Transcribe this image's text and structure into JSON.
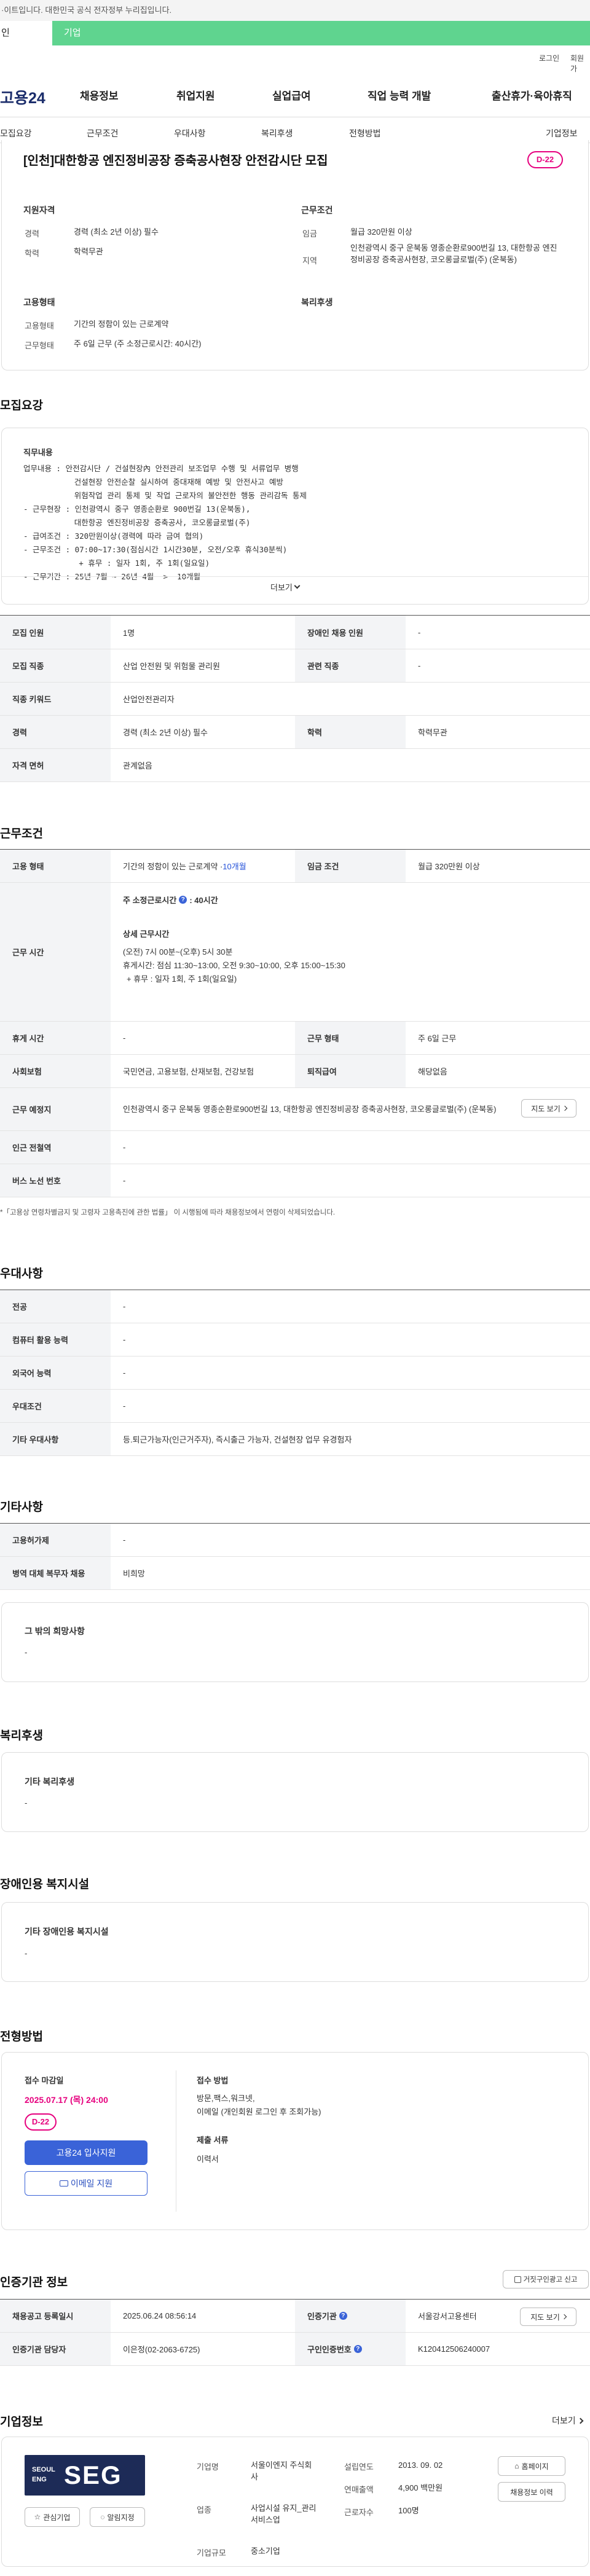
{
  "gov_banner": "·이트입니다. 대한민국 공식 전자정부 누리집입니다.",
  "user_tabs": [
    "인",
    "기업"
  ],
  "util_links": [
    "로그인",
    "회원가"
  ],
  "logo": "고용24",
  "gnb": [
    "채용정보",
    "취업지원",
    "실업급여",
    "직업 능력 개발",
    "출산휴가·육아휴직"
  ],
  "snb": [
    "모집요강",
    "근무조건",
    "우대사항",
    "복리후생",
    "전형방법",
    "기업정보"
  ],
  "summary": {
    "title": "[인천]대한항공 엔진정비공장 증축공사현장 안전감시단 모집",
    "dday": "D-22",
    "h_qual": "지원자격",
    "career_l": "경력",
    "career_v": "경력 (최소 2년 이상) 필수",
    "edu_l": "학력",
    "edu_v": "학력무관",
    "h_emp": "고용형태",
    "emptype_l": "고용형태",
    "emptype_v": "기간의 정함이 있는 근로계약",
    "workshape_l": "근무형태",
    "workshape_v": "주 6일 근무 (주 소정근로시간: 40시간)",
    "h_cond": "근무조건",
    "wage_l": "임금",
    "wage_v": "월급 320만원 이상",
    "loc_l": "지역",
    "loc_v": "인천광역시 중구 운북동 영종순환로900번길 13, 대한항공 엔진정비공장 증축공사현장, 코오롱글로벌(주) (운북동)",
    "h_welfare": "복리후생"
  },
  "recruit": {
    "title": "모집요강",
    "duty_h": "직무내용",
    "duty_text": "업무내용 : 안전감시단 / 건설현장內 안전관리 보조업무 수행 및 서류업무 병행\n           건설현장 안전순찰 실시하여 중대재해 예방 및 안전사고 예방\n           위험작업 관리 통제 및 작업 근로자의 불안전한 행동 관리감독 통제\n- 근무현장 : 인천광역시 중구 영종순환로 900번길 13(운북동),\n           대한항공 엔진정비공장 증축공사, 코오롱글로벌(주)\n- 급여조건 : 320만원이상(경력에 따라 금여 협의)\n- 근무조건 : 07:00~17:30(점심시간 1시간30분, 오전/오후 휴식30분씩)\n            + 휴무 : 일자 1회, 주 1회(일요일)\n- 근무기간 : 25년 7월 ~ 26년 4월  >  10개월",
    "more": "더보기",
    "rows": [
      {
        "l1": "모집 인원",
        "v1": "1명",
        "l2": "장애인 채용 인원",
        "v2": "-"
      },
      {
        "l1": "모집 직종",
        "v1": "산업 안전원 및 위험물 관리원",
        "l2": "관련 직종",
        "v2": "-"
      },
      {
        "l1": "직종 키워드",
        "v1": "산업안전관리자",
        "l2": "",
        "v2": ""
      },
      {
        "l1": "경력",
        "v1": "경력 (최소 2년 이상) 필수",
        "l2": "학력",
        "v2": "학력무관"
      },
      {
        "l1": "자격 면허",
        "v1": "관계없음",
        "l2": "",
        "v2": ""
      }
    ]
  },
  "work": {
    "title": "근무조건",
    "emp_l": "고용 형태",
    "emp_v": "기간의 정함이 있는 근로계약 · ",
    "emp_months": "10개월",
    "wage_l": "임금 조건",
    "wage_v": "월급 320만원 이상",
    "time_l": "근무 시간",
    "time_weekly": "주 소정근로시간",
    "time_hours": ": 40시간",
    "time_detail_h": "상세 근무시간",
    "time_detail_1": "(오전) 7시 00분~(오후) 5시 30분",
    "time_detail_2": "휴게시간: 점심 11:30~13:00, 오전 9:30~10:00, 오후 15:00~15:30",
    "time_detail_3": "+ 휴무 : 일자 1회, 주 1회(일요일)",
    "rest_l": "휴게 시간",
    "rest_v": "-",
    "shape_l": "근무 형태",
    "shape_v": "주 6일 근무",
    "ins_l": "사회보험",
    "ins_v": "국민연금, 고용보험, 산재보험, 건강보험",
    "sev_l": "퇴직급여",
    "sev_v": "해당없음",
    "place_l": "근무 예정지",
    "place_v": "인천광역시 중구 운북동 영종순환로900번길 13, 대한항공 엔진정비공장 증축공사현장, 코오롱글로벌(주) (운북동)",
    "map_btn": "지도 보기",
    "sta_l": "인근 전철역",
    "sta_v": "-",
    "bus_l": "버스 노선 번호",
    "bus_v": "-",
    "note": "*「고용상 연령차별금지 및 고령자 고용촉진에 관한 법률」 이 시행됨에 따라 채용정보에서 연령이 삭제되었습니다."
  },
  "pref": {
    "title": "우대사항",
    "rows": [
      {
        "l": "전공",
        "v": "-"
      },
      {
        "l": "컴퓨터 활용 능력",
        "v": "-"
      },
      {
        "l": "외국어 능력",
        "v": "-"
      },
      {
        "l": "우대조건",
        "v": "-"
      },
      {
        "l": "기타 우대사항",
        "v": "등.퇴근가능자(인근거주자), 즉시출근 가능자, 건설현장 업무 유경험자"
      }
    ]
  },
  "etc": {
    "title": "기타사항",
    "emp_l": "고용허가제",
    "emp_v": "-",
    "mil_l": "병역 대체 복무자 채용",
    "mil_v": "비희망",
    "other_h": "그 밖의 희망사항",
    "other_v": "-"
  },
  "welfare": {
    "title": "복리후생",
    "box_h": "기타 복리후생",
    "box_v": "-"
  },
  "disabled": {
    "title": "장애인용 복지시설",
    "box_h": "기타 장애인용 복지시설",
    "box_v": "-"
  },
  "process": {
    "title": "전형방법",
    "deadline_h": "접수 마감일",
    "deadline_v": "2025.07.17 (목) 24:00",
    "dday": "D-22",
    "apply_btn": "고용24 입사지원",
    "email_btn": "이메일 지원",
    "method_h": "접수 방법",
    "method_v1": "방문,팩스,워크넷,",
    "method_v2": "이메일 (개인회원 로그인 후 조회가능)",
    "docs_h": "제출 서류",
    "docs_v": "이력서"
  },
  "agency": {
    "title": "인증기관 정보",
    "report_btn": "거짓구인광고 신고",
    "reg_l": "채용공고 등록일시",
    "reg_v": "2025.06.24 08:56:14",
    "agency_l": "인증기관",
    "agency_v": "서울강서고용센터",
    "map_btn": "지도 보기",
    "mgr_l": "인증기관 담당자",
    "mgr_v": "이은정(02-2063-6725)",
    "id_l": "구인인증번호",
    "id_v": "K120412506240007"
  },
  "company": {
    "title": "기업정보",
    "more": "더보기",
    "logo_text": "SEG",
    "logo_small_1": "SEOUL",
    "logo_small_2": "ENG",
    "fav_btn": "관심기업",
    "alarm_btn": "알림지정",
    "name_l": "기업명",
    "name_v": "서울이엔지 주식회사",
    "biz_l": "업종",
    "biz_v": "사업시설 유지_관리 서비스업",
    "size_l": "기업규모",
    "size_v": "중소기업",
    "est_l": "설립연도",
    "est_v": "2013. 09. 02",
    "sales_l": "연매출액",
    "sales_v": "4,900 백만원",
    "emp_l": "근로자수",
    "emp_v": "100명",
    "home_btn": "홈페이지",
    "jobs_btn": "채용정보 이력"
  },
  "colors": {
    "brand_green": "#5fd48f",
    "accent_pink": "#e6007e",
    "accent_blue": "#2451d9",
    "navy": "#1b2d6b"
  }
}
